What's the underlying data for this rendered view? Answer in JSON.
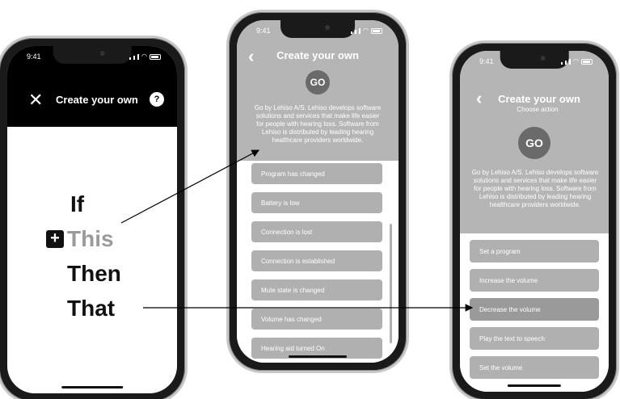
{
  "status_time": "9:41",
  "screen1": {
    "title": "Create your own",
    "help_label": "?",
    "words": [
      "If",
      "This",
      "Then",
      "That"
    ]
  },
  "screen2": {
    "title": "Create your own",
    "logo": "GO",
    "description": "Go by Lehiso A/S. Lehiso develops software solutions and services that make life easier for people with hearing loss. Software from Lehiso is distributed by leading hearing healthcare providers worldwide.",
    "triggers": [
      "Program has changed",
      "Battery is low",
      "Connection is lost",
      "Connection is established",
      "Mute state is changed",
      "Volume has changed",
      "Hearing aid turned On"
    ]
  },
  "screen3": {
    "title": "Create your own",
    "subtitle": "Choose action",
    "logo": "GO",
    "description": "Go by Lehiso A/S. Lehiso develops software solutions and services that make life easier for people with hearing loss. Software from Lehiso is distributed by leading hearing healthcare providers worldwide.",
    "actions": [
      "Set a program",
      "Increase the volume",
      "Decrease the volume",
      "Play the text to speech",
      "Set the volume"
    ]
  },
  "colors": {
    "header_black": "#000000",
    "panel_grey": "#b5b5b5",
    "item_grey": "#b0b0b0",
    "highlight_grey": "#9a9a9a",
    "logo_grey": "#6a6a6a"
  }
}
